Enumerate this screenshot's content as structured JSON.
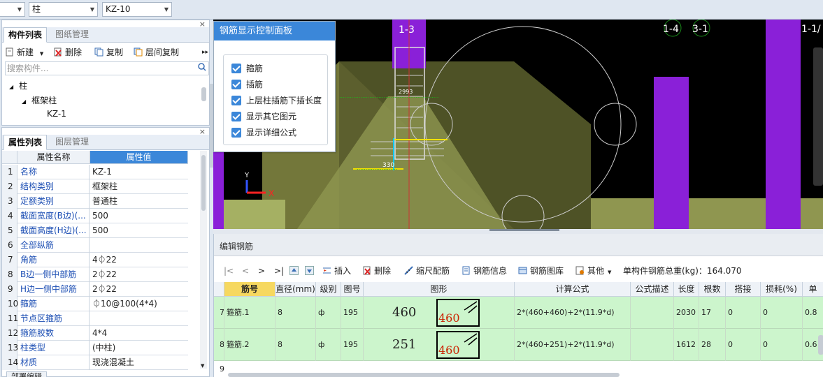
{
  "toolbar": {
    "combo_floor": "",
    "combo_type": "柱",
    "combo_member": "KZ-10"
  },
  "component_panel": {
    "tabs": [
      "构件列表",
      "图纸管理"
    ],
    "buttons": {
      "new": "新建",
      "delete": "删除",
      "copy": "复制",
      "floor_copy": "层间复制"
    },
    "search_placeholder": "搜索构件...",
    "tree": {
      "root": "柱",
      "group": "框架柱",
      "item": "KZ-1"
    }
  },
  "property_panel": {
    "tabs": [
      "属性列表",
      "图层管理"
    ],
    "headers": {
      "name": "属性名称",
      "value": "属性值"
    },
    "rows": [
      {
        "n": "1",
        "name": "名称",
        "value": "KZ-1"
      },
      {
        "n": "2",
        "name": "结构类别",
        "value": "框架柱"
      },
      {
        "n": "3",
        "name": "定额类别",
        "value": "普通柱"
      },
      {
        "n": "4",
        "name": "截面宽度(B边)(...",
        "value": "500"
      },
      {
        "n": "5",
        "name": "截面高度(H边)(...",
        "value": "500"
      },
      {
        "n": "6",
        "name": "全部纵筋",
        "value": ""
      },
      {
        "n": "7",
        "name": "角筋",
        "value": "4⏀22"
      },
      {
        "n": "8",
        "name": "B边一侧中部筋",
        "value": "2⏀22"
      },
      {
        "n": "9",
        "name": "H边一侧中部筋",
        "value": "2⏀22"
      },
      {
        "n": "10",
        "name": "箍筋",
        "value": "⏀10@100(4*4)"
      },
      {
        "n": "11",
        "name": "节点区箍筋",
        "value": ""
      },
      {
        "n": "12",
        "name": "箍筋胶数",
        "value": "4*4"
      },
      {
        "n": "13",
        "name": "柱类型",
        "value": "(中柱)"
      },
      {
        "n": "14",
        "name": "材质",
        "value": "现浇混凝土"
      }
    ],
    "bottom_tab": "部署编辑"
  },
  "viewport": {
    "axis_labels": [
      "1-3",
      "1-4",
      "3-1",
      "1-1/"
    ],
    "dim_330": "330",
    "dim_2993": "2993",
    "axis_y": "Y",
    "axis_x": "X"
  },
  "control_panel": {
    "title": "钢筋显示控制面板",
    "options": [
      "箍筋",
      "插筋",
      "上层柱插筋下插长度",
      "显示其它图元",
      "显示详细公式"
    ]
  },
  "editor": {
    "title": "编辑钢筋",
    "nav": [
      "|<",
      "<",
      ">",
      ">|"
    ],
    "tools": {
      "insert": "插入",
      "delete": "删除",
      "scale": "缩尺配筋",
      "info": "钢筋信息",
      "library": "钢筋图库",
      "other": "其他"
    },
    "total_weight": "单构件钢筋总重(kg)：164.070",
    "columns": [
      "筋号",
      "直径(mm)",
      "级别",
      "图号",
      "图形",
      "计算公式",
      "公式描述",
      "长度",
      "根数",
      "搭接",
      "损耗(%)",
      "单"
    ],
    "rows": [
      {
        "n": "7",
        "name": "箍筋.1",
        "diameter": "8",
        "grade": "ф",
        "fig": "195",
        "shape_a": "460",
        "shape_b": "460",
        "formula": "2*(460+460)+2*(11.9*d)",
        "desc": "",
        "length": "2030",
        "count": "17",
        "lap": "0",
        "loss": "0",
        "unit": "0.8"
      },
      {
        "n": "8",
        "name": "箍筋.2",
        "diameter": "8",
        "grade": "ф",
        "fig": "195",
        "shape_a": "251",
        "shape_b": "460",
        "formula": "2*(460+251)+2*(11.9*d)",
        "desc": "",
        "length": "1612",
        "count": "28",
        "lap": "0",
        "loss": "0",
        "unit": "0.6"
      }
    ],
    "next_row": "9"
  },
  "colors": {
    "accent": "#3b87d9",
    "row_green": "#ccf5cc",
    "header_highlight": "#f6d860",
    "purple": "#8a20d8",
    "olive": "#8f9650"
  }
}
